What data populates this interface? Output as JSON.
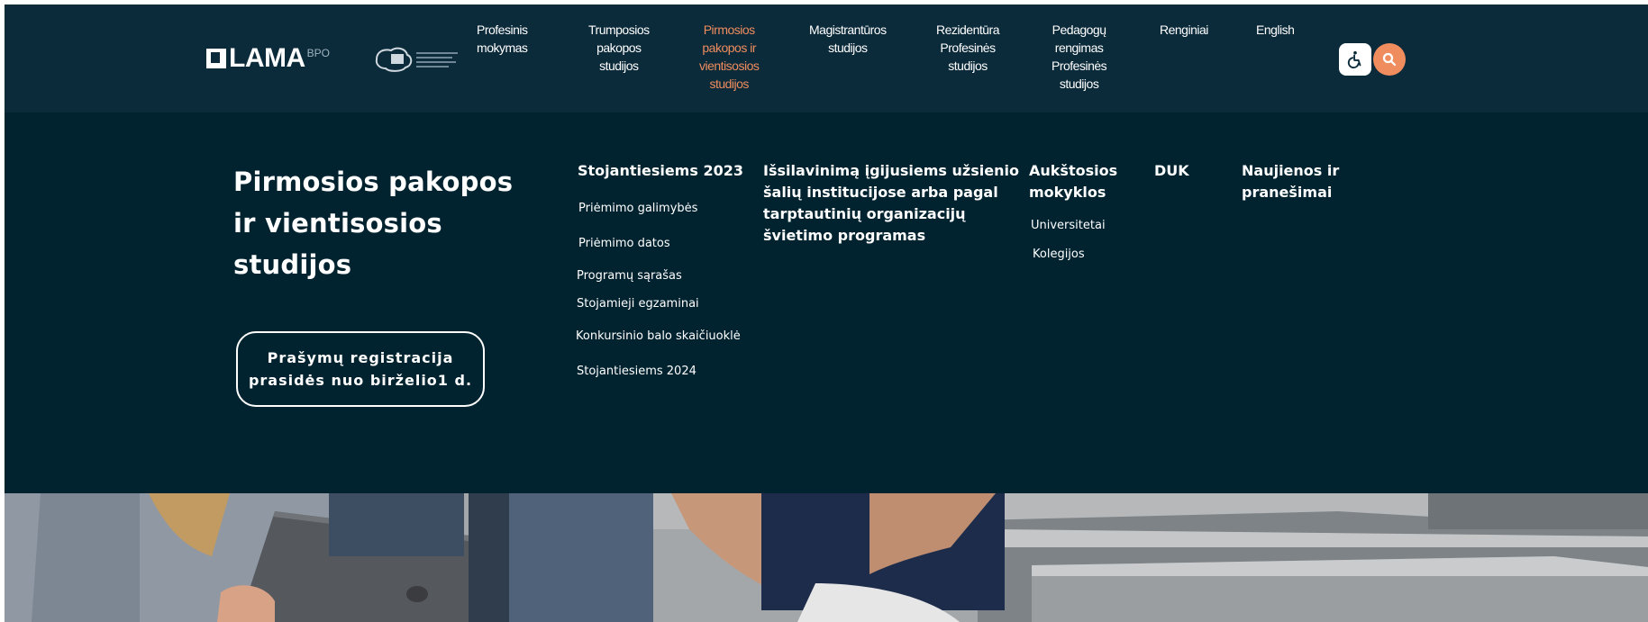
{
  "header": {
    "logo_text": "LAMA",
    "logo_sub": "BPO",
    "nav": [
      {
        "label": "Profesinis\nmokymas",
        "active": false
      },
      {
        "label": "Trumposios\npakopos\nstudijos",
        "active": false
      },
      {
        "label": "Pirmosios\npakopos ir\nvientisosios\nstudijos",
        "active": true
      },
      {
        "label": "Magistrantūros\nstudijos",
        "active": false
      },
      {
        "label": "Rezidentūra\nProfesinės\nstudijos",
        "active": false
      },
      {
        "label": "Pedagogų\nrengimas\nProfesinės\nstudijos",
        "active": false
      },
      {
        "label": "Renginiai",
        "active": false
      },
      {
        "label": "English",
        "active": false
      }
    ],
    "accessibility_icon": "wheelchair-icon",
    "search_icon": "search-icon"
  },
  "mega_menu": {
    "title": "Pirmosios pakopos ir vientisosios studijos",
    "cta_label": "Prašymų registracija\nprasidės nuo birželio1 d.",
    "columns": [
      {
        "heading": "Stojantiesiems 2023",
        "links": [
          "Priėmimo galimybės",
          "Priėmimo datos",
          "Programų sąrašas",
          "Stojamieji egzaminai",
          "Konkursinio balo skaičiuoklė",
          "Stojantiesiems 2024"
        ]
      },
      {
        "heading": "Išsilavinimą įgijusiems užsienio\nšalių institucijose arba pagal\ntarptautinių organizacijų\nšvietimo programas",
        "links": []
      },
      {
        "heading": "Aukštosios\nmokyklos",
        "links": [
          "Universitetai",
          "Kolegijos"
        ]
      },
      {
        "heading": "DUK",
        "links": []
      },
      {
        "heading": "Naujienos ir\npranešimai",
        "links": []
      }
    ]
  },
  "colors": {
    "topbar": "#0b2a3a",
    "panel": "#012330",
    "accent": "#ef8d5e",
    "text": "#ffffff"
  }
}
